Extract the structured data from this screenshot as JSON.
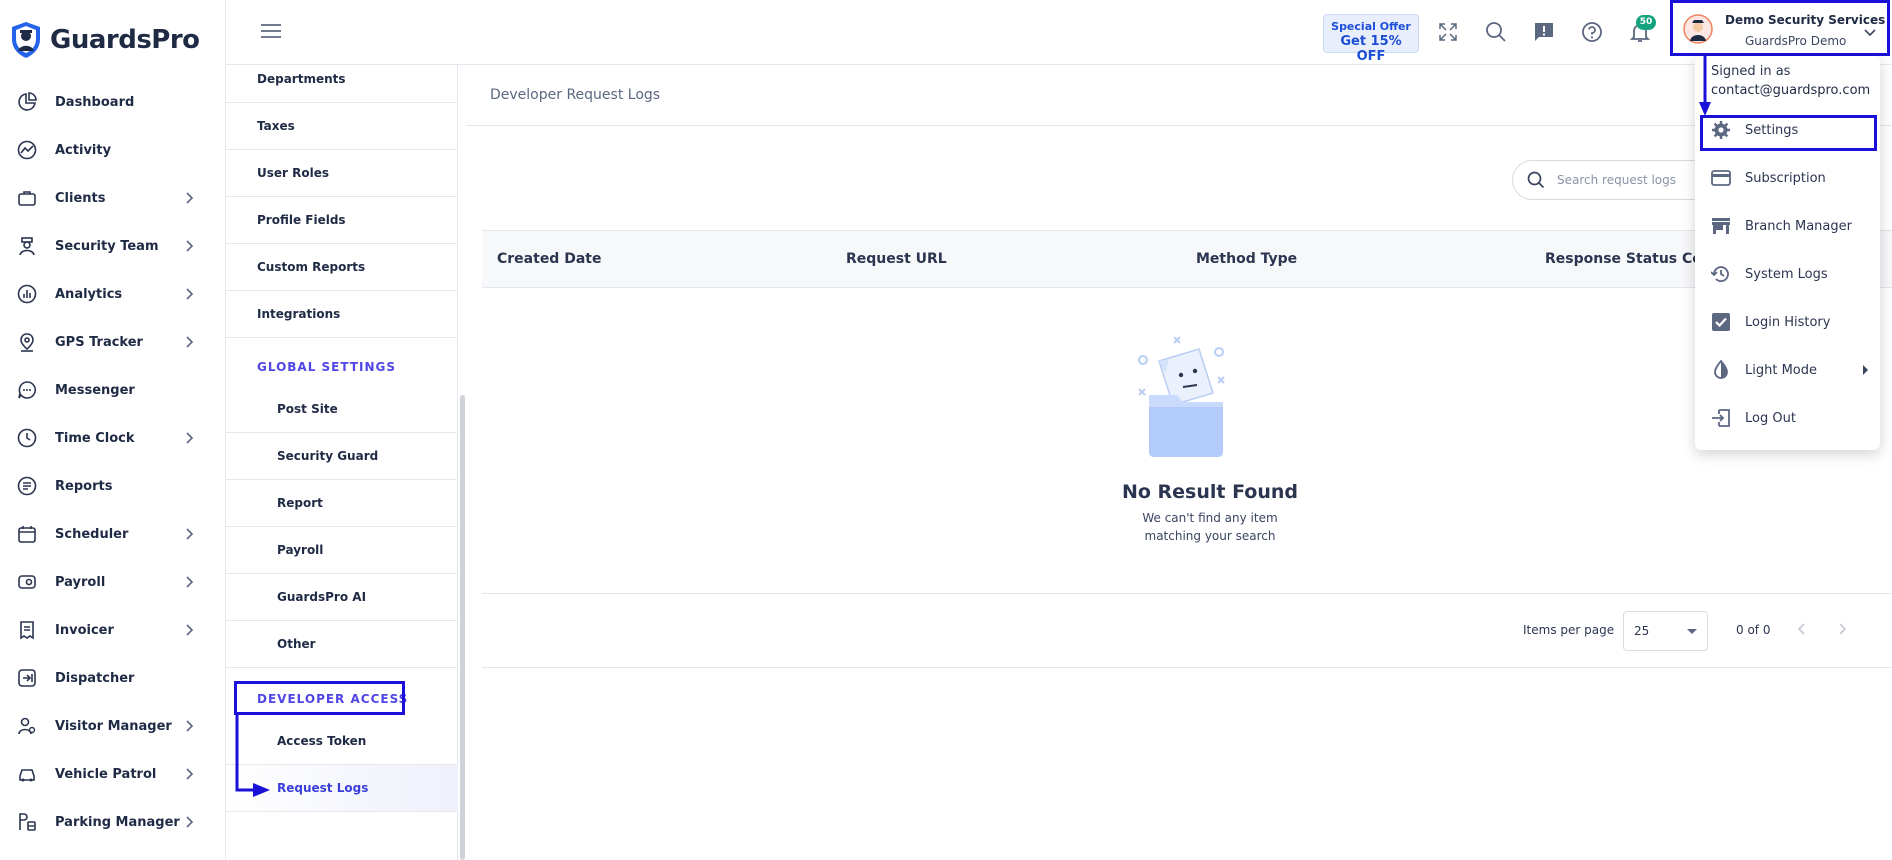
{
  "app": {
    "name": "GuardsPro"
  },
  "nav": {
    "items": [
      {
        "label": "Dashboard",
        "icon": "dashboard-icon",
        "has_children": false
      },
      {
        "label": "Activity",
        "icon": "activity-icon",
        "has_children": false
      },
      {
        "label": "Clients",
        "icon": "clients-icon",
        "has_children": true
      },
      {
        "label": "Security Team",
        "icon": "security-team-icon",
        "has_children": true
      },
      {
        "label": "Analytics",
        "icon": "analytics-icon",
        "has_children": true
      },
      {
        "label": "GPS Tracker",
        "icon": "gps-tracker-icon",
        "has_children": true
      },
      {
        "label": "Messenger",
        "icon": "messenger-icon",
        "has_children": false
      },
      {
        "label": "Time Clock",
        "icon": "time-clock-icon",
        "has_children": true
      },
      {
        "label": "Reports",
        "icon": "reports-icon",
        "has_children": false
      },
      {
        "label": "Scheduler",
        "icon": "scheduler-icon",
        "has_children": true
      },
      {
        "label": "Payroll",
        "icon": "payroll-icon",
        "has_children": true
      },
      {
        "label": "Invoicer",
        "icon": "invoicer-icon",
        "has_children": true
      },
      {
        "label": "Dispatcher",
        "icon": "dispatcher-icon",
        "has_children": false
      },
      {
        "label": "Visitor Manager",
        "icon": "visitor-manager-icon",
        "has_children": true
      },
      {
        "label": "Vehicle Patrol",
        "icon": "vehicle-patrol-icon",
        "has_children": true
      },
      {
        "label": "Parking Manager",
        "icon": "parking-manager-icon",
        "has_children": true
      }
    ]
  },
  "settings_nav": {
    "items": [
      "Departments",
      "Taxes",
      "User Roles",
      "Profile Fields",
      "Custom Reports",
      "Integrations"
    ],
    "global_title": "GLOBAL SETTINGS",
    "global_items": [
      "Post Site",
      "Security Guard",
      "Report",
      "Payroll",
      "GuardsPro AI",
      "Other"
    ],
    "dev_title": "DEVELOPER ACCESS",
    "dev_items": [
      "Access Token",
      "Request Logs"
    ],
    "active": "Request Logs"
  },
  "header": {
    "offer_line1": "Special Offer",
    "offer_line2": "Get 15% OFF",
    "notification_count": "50",
    "user_name": "Demo Security Services",
    "user_org": "GuardsPro Demo"
  },
  "main": {
    "title": "Developer Request Logs",
    "search_placeholder": "Search request logs",
    "columns": [
      "Created Date",
      "Request URL",
      "Method Type",
      "Response Status Cod"
    ],
    "empty_title": "No Result Found",
    "empty_line1": "We can't find any item",
    "empty_line2": "matching your search",
    "items_per_page_label": "Items per page",
    "items_per_page": "25",
    "range": "0 of 0"
  },
  "dropdown": {
    "signed_in_label": "Signed in as",
    "email": "contact@guardspro.com",
    "items": [
      {
        "label": "Settings",
        "icon": "gear-icon"
      },
      {
        "label": "Subscription",
        "icon": "credit-card-icon"
      },
      {
        "label": "Branch Manager",
        "icon": "store-icon"
      },
      {
        "label": "System Logs",
        "icon": "history-icon"
      },
      {
        "label": "Login History",
        "icon": "checkbox-icon"
      },
      {
        "label": "Light Mode",
        "icon": "contrast-icon"
      },
      {
        "label": "Log Out",
        "icon": "logout-icon"
      }
    ]
  },
  "colors": {
    "accent": "#4f46e5",
    "annotation": "#1a10d8",
    "brand": "#1d4ed8",
    "badge": "#14a37f"
  }
}
